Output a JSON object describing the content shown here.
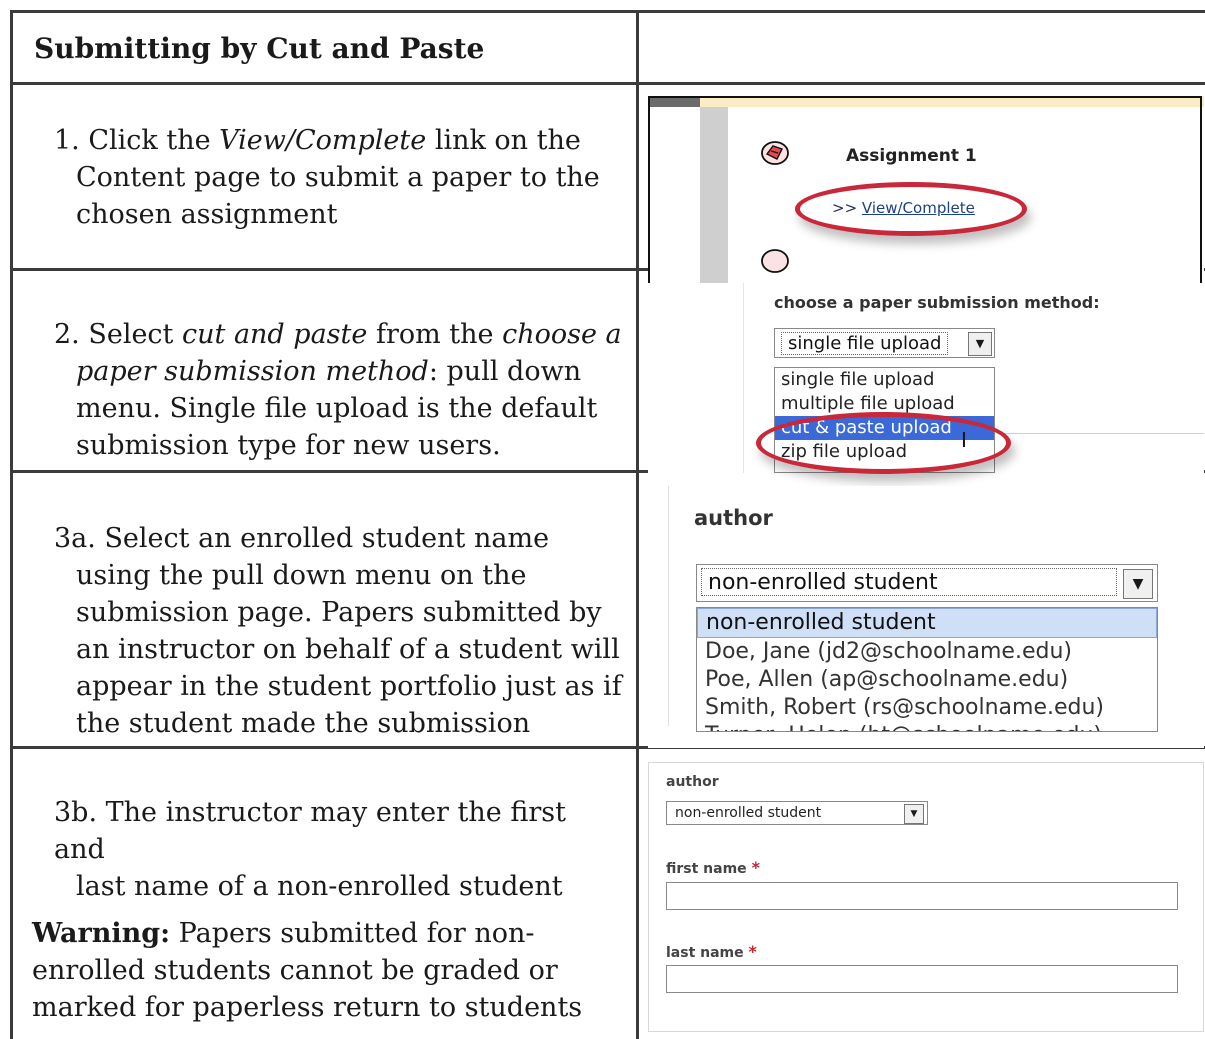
{
  "header": {
    "title": "Submitting by Cut and Paste"
  },
  "steps": [
    {
      "lines": [
        "1. Click the ",
        "View/Complete",
        " link on the",
        "Content page to submit a paper to the",
        "chosen assignment"
      ]
    },
    {
      "lines": [
        "2. Select ",
        "cut and paste",
        " from the ",
        "choose a",
        "paper submission method",
        ": pull down",
        "menu. Single file upload is the default",
        "submission type for new users."
      ]
    },
    {
      "lines": [
        "3a. Select an enrolled student name",
        "using the pull down menu on the",
        "submission page. Papers submitted by",
        "an instructor on behalf of a student will",
        "appear in the student portfolio just as if",
        "the student made the submission"
      ]
    },
    {
      "lines": [
        "3b. The instructor may enter the first and",
        "last name of a non-enrolled student"
      ],
      "warning_label": "Warning:",
      "warning_lines": [
        " Papers submitted for non-",
        "enrolled students cannot be graded or",
        "marked for paperless return to students"
      ]
    }
  ],
  "shot1": {
    "assignment_title": "Assignment 1",
    "link_prefix": ">> ",
    "link_text": "View/Complete",
    "icon": "assignment-icon"
  },
  "shot2": {
    "label": "choose a paper submission method:",
    "selected": "single file upload",
    "options": [
      "single file upload",
      "multiple file upload",
      "cut & paste upload",
      "zip file upload"
    ],
    "highlighted": "cut & paste upload"
  },
  "shot3": {
    "label": "author",
    "selected": "non-enrolled student",
    "options": [
      "non-enrolled student",
      "Doe, Jane (jd2@schoolname.edu)",
      "Poe, Allen (ap@schoolname.edu)",
      "Smith, Robert (rs@schoolname.edu)",
      "Turner, Helen (ht@schoolname.edu)"
    ]
  },
  "shot4": {
    "author_label": "author",
    "author_selected": "non-enrolled student",
    "first_name_label": "first name",
    "last_name_label": "last name",
    "required_mark": "*"
  },
  "colors": {
    "highlight": "#c8283a",
    "selected_option": "#3b6ad8",
    "grid": "#3b3b3b"
  }
}
